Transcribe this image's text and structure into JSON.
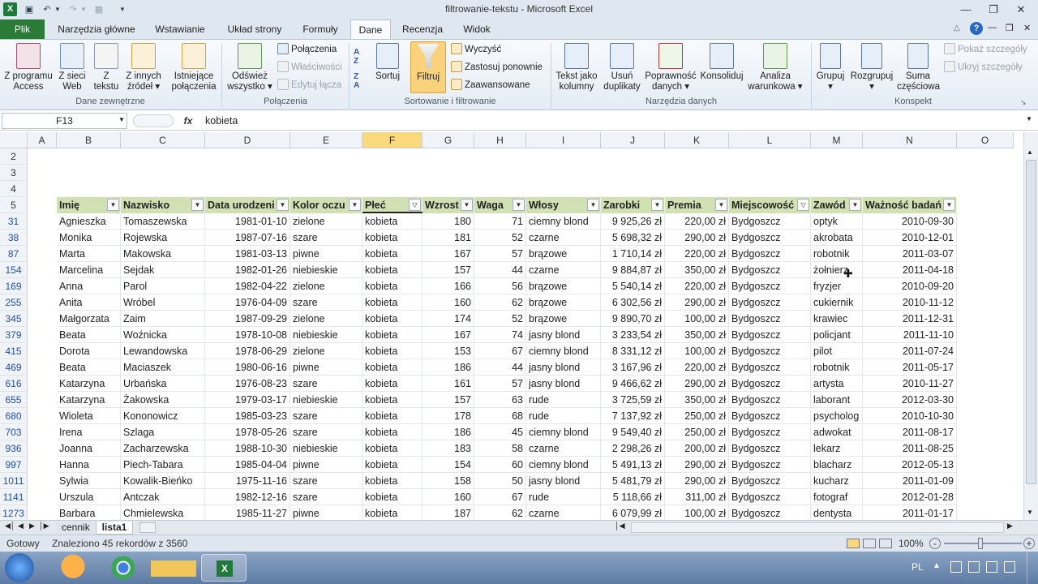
{
  "window": {
    "title": "filtrowanie-tekstu - Microsoft Excel"
  },
  "tabs": [
    "Plik",
    "Narzędzia główne",
    "Wstawianie",
    "Układ strony",
    "Formuły",
    "Dane",
    "Recenzja",
    "Widok"
  ],
  "ribbon": {
    "groups": [
      "Dane zewnętrzne",
      "Połączenia",
      "Sortowanie i filtrowanie",
      "Narzędzia danych",
      "Konspekt"
    ],
    "ext": [
      {
        "l1": "Z programu",
        "l2": "Access"
      },
      {
        "l1": "Z sieci",
        "l2": "Web"
      },
      {
        "l1": "Z",
        "l2": "tekstu"
      },
      {
        "l1": "Z innych",
        "l2": "źródeł ▾"
      },
      {
        "l1": "Istniejące",
        "l2": "połączenia"
      }
    ],
    "refresh": {
      "l1": "Odśwież",
      "l2": "wszystko ▾"
    },
    "conn_small": [
      "Połączenia",
      "Właściwości",
      "Edytuj łącza"
    ],
    "sort_az": "Sortuj",
    "filter": "Filtruj",
    "filter_small": [
      "Wyczyść",
      "Zastosuj ponownie",
      "Zaawansowane"
    ],
    "tools": [
      {
        "l1": "Tekst jako",
        "l2": "kolumny"
      },
      {
        "l1": "Usuń",
        "l2": "duplikaty"
      },
      {
        "l1": "Poprawność",
        "l2": "danych ▾"
      },
      {
        "l1": "Konsoliduj",
        "l2": ""
      },
      {
        "l1": "Analiza",
        "l2": "warunkowa ▾"
      }
    ],
    "outline": [
      {
        "l1": "Grupuj",
        "l2": "▾"
      },
      {
        "l1": "Rozgrupuj",
        "l2": "▾"
      },
      {
        "l1": "Suma",
        "l2": "częściowa"
      }
    ],
    "outline_small": [
      "Pokaż szczegóły",
      "Ukryj szczegóły"
    ]
  },
  "formula": {
    "namebox": "F13",
    "fx": "fx",
    "value": "kobieta"
  },
  "columns": [
    "A",
    "B",
    "C",
    "D",
    "E",
    "F",
    "G",
    "H",
    "I",
    "J",
    "K",
    "L",
    "M",
    "N",
    "O"
  ],
  "empty_rows": [
    "2",
    "3",
    "4"
  ],
  "header_row": "5",
  "headers": [
    "Imię",
    "Nazwisko",
    "Data urodzeni",
    "Kolor oczu",
    "Płeć",
    "Wzrost",
    "Waga",
    "Włosy",
    "Zarobki",
    "Premia",
    "Miejscowość",
    "Zawód",
    "Ważność badań"
  ],
  "rows": [
    [
      "31",
      "Agnieszka",
      "Tomaszewska",
      "1981-01-10",
      "zielone",
      "kobieta",
      "180",
      "71",
      "ciemny blond",
      "9 925,26 zł",
      "220,00 zł",
      "Bydgoszcz",
      "optyk",
      "2010-09-30"
    ],
    [
      "38",
      "Monika",
      "Rojewska",
      "1987-07-16",
      "szare",
      "kobieta",
      "181",
      "52",
      "czarne",
      "5 698,32 zł",
      "290,00 zł",
      "Bydgoszcz",
      "akrobata",
      "2010-12-01"
    ],
    [
      "87",
      "Marta",
      "Makowska",
      "1981-03-13",
      "piwne",
      "kobieta",
      "167",
      "57",
      "brązowe",
      "1 710,14 zł",
      "220,00 zł",
      "Bydgoszcz",
      "robotnik",
      "2011-03-07"
    ],
    [
      "154",
      "Marcelina",
      "Sejdak",
      "1982-01-26",
      "niebieskie",
      "kobieta",
      "157",
      "44",
      "czarne",
      "9 884,87 zł",
      "350,00 zł",
      "Bydgoszcz",
      "żołnierz",
      "2011-04-18"
    ],
    [
      "169",
      "Anna",
      "Parol",
      "1982-04-22",
      "zielone",
      "kobieta",
      "166",
      "56",
      "brązowe",
      "5 540,14 zł",
      "220,00 zł",
      "Bydgoszcz",
      "fryzjer",
      "2010-09-20"
    ],
    [
      "255",
      "Anita",
      "Wróbel",
      "1976-04-09",
      "szare",
      "kobieta",
      "160",
      "62",
      "brązowe",
      "6 302,56 zł",
      "290,00 zł",
      "Bydgoszcz",
      "cukiernik",
      "2010-11-12"
    ],
    [
      "345",
      "Małgorzata",
      "Zaim",
      "1987-09-29",
      "zielone",
      "kobieta",
      "174",
      "52",
      "brązowe",
      "9 890,70 zł",
      "100,00 zł",
      "Bydgoszcz",
      "krawiec",
      "2011-12-31"
    ],
    [
      "379",
      "Beata",
      "Woźnicka",
      "1978-10-08",
      "niebieskie",
      "kobieta",
      "167",
      "74",
      "jasny blond",
      "3 233,54 zł",
      "350,00 zł",
      "Bydgoszcz",
      "policjant",
      "2011-11-10"
    ],
    [
      "415",
      "Dorota",
      "Lewandowska",
      "1978-06-29",
      "zielone",
      "kobieta",
      "153",
      "67",
      "ciemny blond",
      "8 331,12 zł",
      "100,00 zł",
      "Bydgoszcz",
      "pilot",
      "2011-07-24"
    ],
    [
      "469",
      "Beata",
      "Maciaszek",
      "1980-06-16",
      "piwne",
      "kobieta",
      "186",
      "44",
      "jasny blond",
      "3 167,96 zł",
      "220,00 zł",
      "Bydgoszcz",
      "robotnik",
      "2011-05-17"
    ],
    [
      "616",
      "Katarzyna",
      "Urbańska",
      "1976-08-23",
      "szare",
      "kobieta",
      "161",
      "57",
      "jasny blond",
      "9 466,62 zł",
      "290,00 zł",
      "Bydgoszcz",
      "artysta",
      "2010-11-27"
    ],
    [
      "655",
      "Katarzyna",
      "Żakowska",
      "1979-03-17",
      "niebieskie",
      "kobieta",
      "157",
      "63",
      "rude",
      "3 725,59 zł",
      "350,00 zł",
      "Bydgoszcz",
      "laborant",
      "2012-03-30"
    ],
    [
      "680",
      "Wioleta",
      "Kononowicz",
      "1985-03-23",
      "szare",
      "kobieta",
      "178",
      "68",
      "rude",
      "7 137,92 zł",
      "250,00 zł",
      "Bydgoszcz",
      "psycholog",
      "2010-10-30"
    ],
    [
      "703",
      "Irena",
      "Szlaga",
      "1978-05-26",
      "szare",
      "kobieta",
      "186",
      "45",
      "ciemny blond",
      "9 549,40 zł",
      "250,00 zł",
      "Bydgoszcz",
      "adwokat",
      "2011-08-17"
    ],
    [
      "936",
      "Joanna",
      "Zacharzewska",
      "1988-10-30",
      "niebieskie",
      "kobieta",
      "183",
      "58",
      "czarne",
      "2 298,26 zł",
      "200,00 zł",
      "Bydgoszcz",
      "lekarz",
      "2011-08-25"
    ],
    [
      "997",
      "Hanna",
      "Piech-Tabara",
      "1985-04-04",
      "piwne",
      "kobieta",
      "154",
      "60",
      "ciemny blond",
      "5 491,13 zł",
      "290,00 zł",
      "Bydgoszcz",
      "blacharz",
      "2012-05-13"
    ],
    [
      "1011",
      "Sylwia",
      "Kowalik-Bieńko",
      "1975-11-16",
      "szare",
      "kobieta",
      "158",
      "50",
      "jasny blond",
      "5 481,79 zł",
      "290,00 zł",
      "Bydgoszcz",
      "kucharz",
      "2011-01-09"
    ],
    [
      "1141",
      "Urszula",
      "Antczak",
      "1982-12-16",
      "szare",
      "kobieta",
      "160",
      "67",
      "rude",
      "5 118,66 zł",
      "311,00 zł",
      "Bydgoszcz",
      "fotograf",
      "2012-01-28"
    ],
    [
      "1273",
      "Barbara",
      "Chmielewska",
      "1985-11-27",
      "piwne",
      "kobieta",
      "187",
      "62",
      "czarne",
      "6 079,99 zł",
      "100,00 zł",
      "Bydgoszcz",
      "dentysta",
      "2011-01-17"
    ]
  ],
  "sheets": [
    "cennik",
    "lista1"
  ],
  "status": {
    "ready": "Gotowy",
    "found": "Znaleziono 45 rekordów z 3560",
    "zoom": "100%"
  },
  "taskbar": {
    "lang": "PL"
  },
  "colors": {
    "file_tab": "#2c7a38",
    "header_fill": "#d2e1b4",
    "selected_col": "#f9d97b"
  }
}
